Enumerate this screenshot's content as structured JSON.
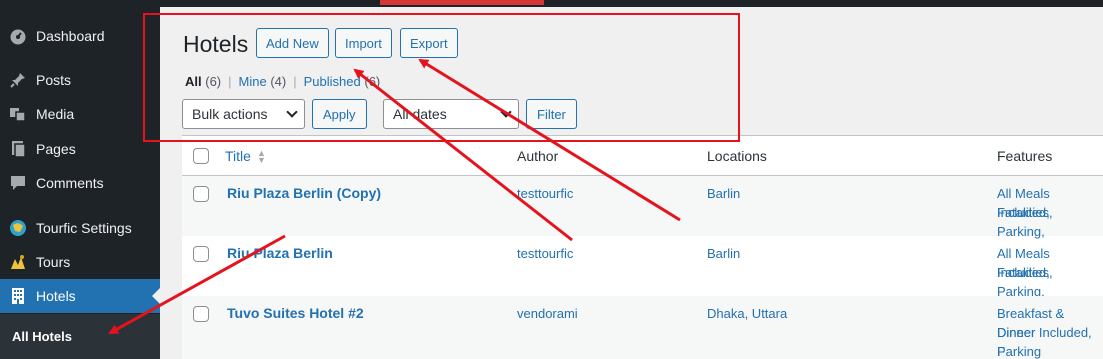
{
  "sidebar": {
    "items": [
      {
        "label": "Dashboard",
        "icon": "dashboard-icon"
      },
      {
        "label": "Posts",
        "icon": "pin-icon"
      },
      {
        "label": "Media",
        "icon": "media-icon"
      },
      {
        "label": "Pages",
        "icon": "pages-icon"
      },
      {
        "label": "Comments",
        "icon": "comment-icon"
      },
      {
        "label": "Tourfic Settings",
        "icon": "tourfic-icon"
      },
      {
        "label": "Tours",
        "icon": "tours-icon"
      },
      {
        "label": "Hotels",
        "icon": "building-icon"
      }
    ],
    "submenu_active": "All Hotels"
  },
  "page": {
    "title": "Hotels",
    "buttons": {
      "add_new": "Add New",
      "import": "Import",
      "export": "Export"
    },
    "views": {
      "all": "All",
      "all_count": "(6)",
      "mine": "Mine",
      "mine_count": "(4)",
      "published": "Published",
      "published_count": "(6)",
      "separator": "|"
    },
    "bulk_actions": {
      "selected": "Bulk actions",
      "apply": "Apply"
    },
    "date_filter": {
      "selected": "All dates",
      "filter": "Filter"
    }
  },
  "table": {
    "columns": {
      "title": "Title",
      "author": "Author",
      "locations": "Locations",
      "features": "Features"
    },
    "rows": [
      {
        "title": "Riu Plaza Berlin (Copy)",
        "author": "testtourfic",
        "location": "Barlin",
        "features_line1": "All Meals Included,",
        "features_line2": "Fatalities, Parking,",
        "features_line3": ""
      },
      {
        "title": "Riu Plaza Berlin",
        "author": "testtourfic",
        "location": "Barlin",
        "features_line1": "All Meals Included,",
        "features_line2": "Fatalities, Parking,",
        "features_line3": ""
      },
      {
        "title": "Tuvo Suites Hotel #2",
        "author": "vendorami",
        "location": "Dhaka, Uttara",
        "features_line1": "Breakfast & Dineer",
        "features_line2": "Dinner Included, F",
        "features_line3": "Parking"
      }
    ]
  },
  "colors": {
    "accent": "#2271b1",
    "sidebar": "#1d2327",
    "annotation": "#e5131d"
  }
}
